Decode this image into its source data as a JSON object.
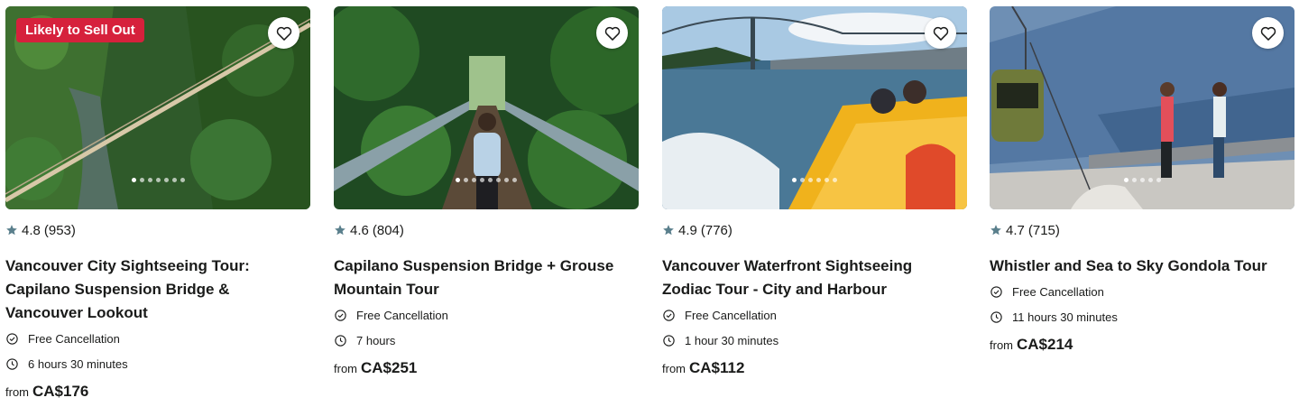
{
  "cards": [
    {
      "badge": "Likely to Sell Out",
      "rating": "4.8",
      "reviews": "(953)",
      "title": "Vancouver City Sightseeing Tour: Capilano Suspension Bridge & Vancouver Lookout",
      "cancellation": "Free Cancellation",
      "duration": "6 hours 30 minutes",
      "price_prefix": "from",
      "price": "CA$176",
      "image_icon": "suspension-bridge-canyon-photo"
    },
    {
      "badge": "",
      "rating": "4.6",
      "reviews": "(804)",
      "title": "Capilano Suspension Bridge + Grouse Mountain Tour",
      "cancellation": "Free Cancellation",
      "duration": "7 hours",
      "price_prefix": "from",
      "price": "CA$251",
      "image_icon": "hiker-on-bridge-photo"
    },
    {
      "badge": "",
      "rating": "4.9",
      "reviews": "(776)",
      "title": "Vancouver Waterfront Sightseeing Zodiac Tour - City and Harbour",
      "cancellation": "Free Cancellation",
      "duration": "1 hour 30 minutes",
      "price_prefix": "from",
      "price": "CA$112",
      "image_icon": "zodiac-boat-lions-gate-photo"
    },
    {
      "badge": "",
      "rating": "4.7",
      "reviews": "(715)",
      "title": "Whistler and Sea to Sky Gondola Tour",
      "cancellation": "Free Cancellation",
      "duration": "11 hours 30 minutes",
      "price_prefix": "from",
      "price": "CA$214",
      "image_icon": "gondola-mountain-photo"
    }
  ],
  "colors": {
    "badge_bg": "#d6213c",
    "star": "#5a7f8c",
    "text": "#1a1b1a"
  },
  "icons": {
    "favorite": "heart-outline-icon",
    "rating": "star-icon",
    "cancellation": "check-circle-icon",
    "duration": "clock-icon"
  }
}
